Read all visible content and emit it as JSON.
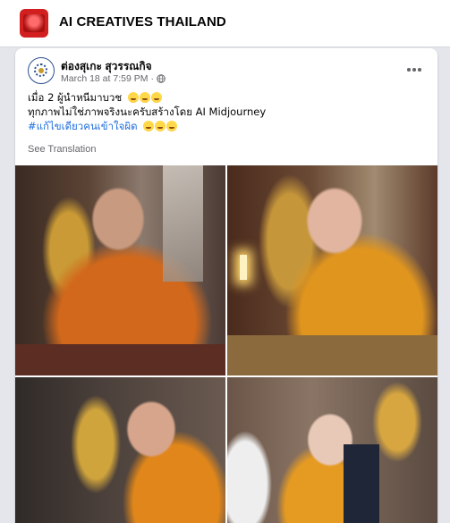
{
  "group": {
    "name": "AI CREATIVES THAILAND"
  },
  "post": {
    "author": "ต่องสุเกะ สุวรรณกิจ",
    "date": "March 18 at 7:59 PM",
    "privacy_icon": "globe-icon",
    "text_line1": "เมื่อ 2 ผู้นำหนีมาบวช",
    "text_line1_emojis": [
      "grinning-sweat-emoji",
      "grinning-sweat-emoji",
      "grinning-sweat-emoji"
    ],
    "text_line2": "ทุกภาพไม่ใช่ภาพจริงนะครับสร้างโดย AI Midjourney",
    "hashtag": "#แก้ไขเดียวคนเข้าใจผิด",
    "hashtag_emojis": [
      "grinning-sweat-emoji",
      "grinning-sweat-emoji",
      "grinning-sweat-emoji"
    ],
    "see_translation": "See Translation",
    "more_icon": "more-horizontal-icon",
    "photos": [
      {
        "name": "monk-photo-1"
      },
      {
        "name": "monk-photo-2"
      },
      {
        "name": "monk-photo-3"
      },
      {
        "name": "monk-photo-4"
      }
    ]
  },
  "colors": {
    "link": "#216fdb",
    "muted": "#65676b",
    "background": "#e4e6eb"
  }
}
